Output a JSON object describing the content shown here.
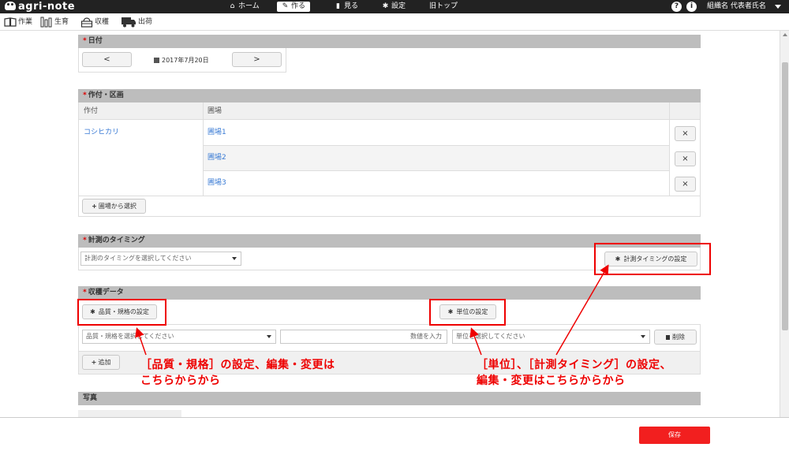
{
  "app": {
    "name": "agri-note"
  },
  "topnav": {
    "items": [
      {
        "label": "ホーム",
        "icon": "home-icon",
        "glyph": "⌂"
      },
      {
        "label": "作る",
        "icon": "pencil-icon",
        "glyph": "✎"
      },
      {
        "label": "見る",
        "icon": "book-icon",
        "glyph": "▮"
      },
      {
        "label": "設定",
        "icon": "gear-icon",
        "glyph": "✱"
      },
      {
        "label": "旧トップ"
      }
    ],
    "help": "?",
    "info": "i",
    "org": "組織名 代表者氏名"
  },
  "subnav": {
    "items": [
      {
        "label": "作業",
        "icon": "book-open-icon"
      },
      {
        "label": "生育",
        "icon": "growth-chart-icon"
      },
      {
        "label": "収穫",
        "icon": "basket-icon"
      },
      {
        "label": "出荷",
        "icon": "truck-icon"
      }
    ]
  },
  "date_section": {
    "title": "日付",
    "prev": "<",
    "next": ">",
    "value": "2017年7月20日"
  },
  "crop_section": {
    "title": "作付・区画",
    "col_crop": "作付",
    "col_field": "圃場",
    "crop": "コシヒカリ",
    "fields": [
      "圃場1",
      "圃場2",
      "圃場3"
    ],
    "remove": "×",
    "select_field": "圃場から選択"
  },
  "timing_section": {
    "title": "計測のタイミング",
    "select_placeholder": "計測のタイミングを選択してください",
    "settings_button": "計測タイミングの設定"
  },
  "harvest_section": {
    "title": "収穫データ",
    "quality_button": "品質・規格の設定",
    "unit_button": "単位の設定",
    "quality_select": "品質・規格を選択してください",
    "value_placeholder": "数値を入力",
    "unit_select": "単位を選択してください",
    "delete": "削除",
    "add": "追加"
  },
  "photo_section": {
    "title": "写真"
  },
  "annotations": {
    "left_line1": "［品質・規格］の設定、編集・変更は",
    "left_line2": "こちらからから",
    "right_line1": "［単位］、［計測タイミング］の設定、",
    "right_line2": "編集・変更はこちらからから"
  },
  "footer": {
    "save": "保存"
  },
  "colors": {
    "accent": "#f21f1f",
    "annotation": "#ee0000",
    "link": "#3a7bd5",
    "section": "#bdbdbd"
  }
}
